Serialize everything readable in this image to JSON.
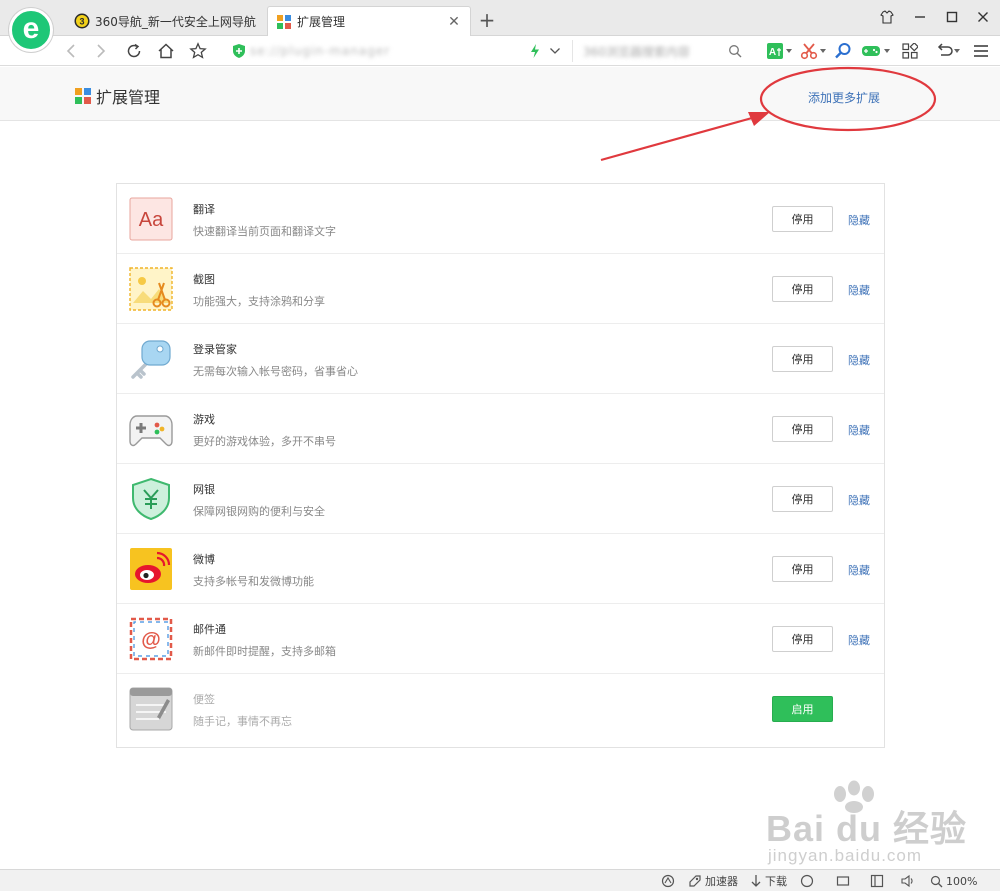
{
  "browser": {
    "logo_letter": "e",
    "tabs": [
      {
        "title": "360导航_新一代安全上网导航",
        "active": false
      },
      {
        "title": "扩展管理",
        "active": true
      }
    ],
    "new_tab_label": "+",
    "url_text": "se://plugin-manager",
    "search_text": "360浏览器搜索内容"
  },
  "page": {
    "title": "扩展管理",
    "add_more_label": "添加更多扩展"
  },
  "extensions": [
    {
      "name": "翻译",
      "desc": "快速翻译当前页面和翻译文字",
      "toggle": "停用",
      "hide": "隐藏",
      "icon": "translate-icon",
      "enabled": true
    },
    {
      "name": "截图",
      "desc": "功能强大，支持涂鸦和分享",
      "toggle": "停用",
      "hide": "隐藏",
      "icon": "screenshot-icon",
      "enabled": true
    },
    {
      "name": "登录管家",
      "desc": "无需每次输入帐号密码，省事省心",
      "toggle": "停用",
      "hide": "隐藏",
      "icon": "key-icon",
      "enabled": true
    },
    {
      "name": "游戏",
      "desc": "更好的游戏体验，多开不串号",
      "toggle": "停用",
      "hide": "隐藏",
      "icon": "gamepad-icon",
      "enabled": true
    },
    {
      "name": "网银",
      "desc": "保障网银网购的便利与安全",
      "toggle": "停用",
      "hide": "隐藏",
      "icon": "shield-yen-icon",
      "enabled": true
    },
    {
      "name": "微博",
      "desc": "支持多帐号和发微博功能",
      "toggle": "停用",
      "hide": "隐藏",
      "icon": "weibo-icon",
      "enabled": true
    },
    {
      "name": "邮件通",
      "desc": "新邮件即时提醒，支持多邮箱",
      "toggle": "停用",
      "hide": "隐藏",
      "icon": "mail-icon",
      "enabled": true
    },
    {
      "name": "便签",
      "desc": "随手记，事情不再忘",
      "toggle": "启用",
      "hide": "",
      "icon": "notepad-icon",
      "enabled": false
    }
  ],
  "statusbar": {
    "accelerator": "加速器",
    "download": "下载",
    "zoom": "100%"
  },
  "watermark": {
    "main": "Bai du 经验",
    "sub": "jingyan.baidu.com"
  },
  "colors": {
    "link": "#3f73b8",
    "enable_button": "#2fbf5a",
    "annotation": "#e0393e",
    "brand": "#1ec777"
  }
}
